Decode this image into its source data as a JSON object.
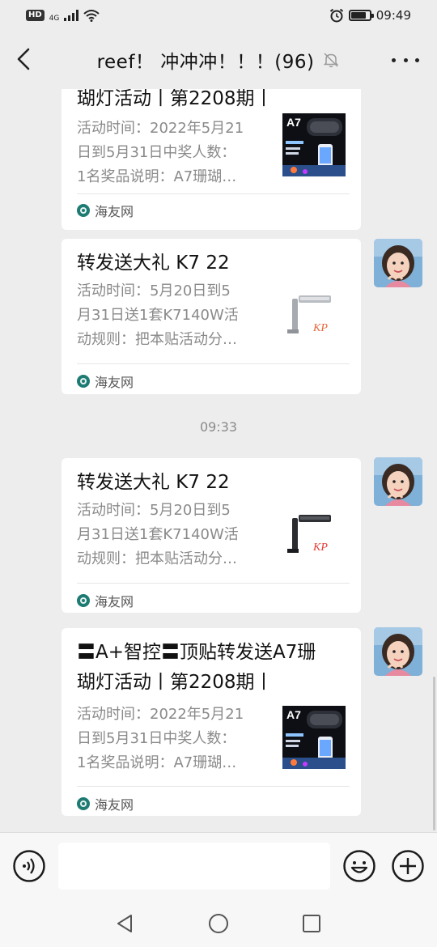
{
  "status_bar": {
    "hd_badge": "HD",
    "network": "4G",
    "time": "09:49",
    "icons": [
      "signal-icon",
      "wifi-icon",
      "alarm-icon",
      "battery-icon"
    ],
    "battery_level": 0.85
  },
  "header": {
    "title": "reef！ 冲冲冲！！！(96)",
    "back_icon": "chevron-left-icon",
    "mute_icon": "bell-muted-icon",
    "more_icon": "more-dots-icon"
  },
  "messages": [
    {
      "title": "瑚灯活动丨第2208期丨",
      "description": [
        "活动时间：2022年5月21",
        "日到5月31日中奖人数：",
        "1名奖品说明：A7珊瑚…"
      ],
      "source": "海友网",
      "thumb_label": "A7",
      "has_avatar": false
    },
    {
      "title": "转发送大礼 K7 22",
      "description": [
        "活动时间：5月20日到5",
        "月31日送1套K7140W活",
        "动规则：把本贴活动分…"
      ],
      "source": "海友网",
      "thumb_label": "K7",
      "has_avatar": true
    },
    {
      "title": "转发送大礼 K7 22",
      "description": [
        "活动时间：5月20日到5",
        "月31日送1套K7140W活",
        "动规则：把本贴活动分…"
      ],
      "source": "海友网",
      "thumb_label": "K7",
      "has_avatar": true
    },
    {
      "title_lines": [
        "〓A+智控〓顶贴转发送A7珊",
        "瑚灯活动丨第2208期丨"
      ],
      "description": [
        "活动时间：2022年5月21",
        "日到5月31日中奖人数：",
        "1名奖品说明：A7珊瑚…"
      ],
      "source": "海友网",
      "thumb_label": "A7",
      "has_avatar": true
    }
  ],
  "timestamp": "09:33",
  "input_bar": {
    "voice_icon": "voice-icon",
    "emoji_icon": "emoji-icon",
    "plus_icon": "plus-icon",
    "input_value": ""
  },
  "nav_bar": {
    "icons": [
      "back-triangle-icon",
      "home-circle-icon",
      "recents-square-icon"
    ]
  },
  "colors": {
    "background": "#ededed",
    "card": "#ffffff",
    "muted_text": "#8a8a8a",
    "source_icon": "#1e7b73"
  }
}
